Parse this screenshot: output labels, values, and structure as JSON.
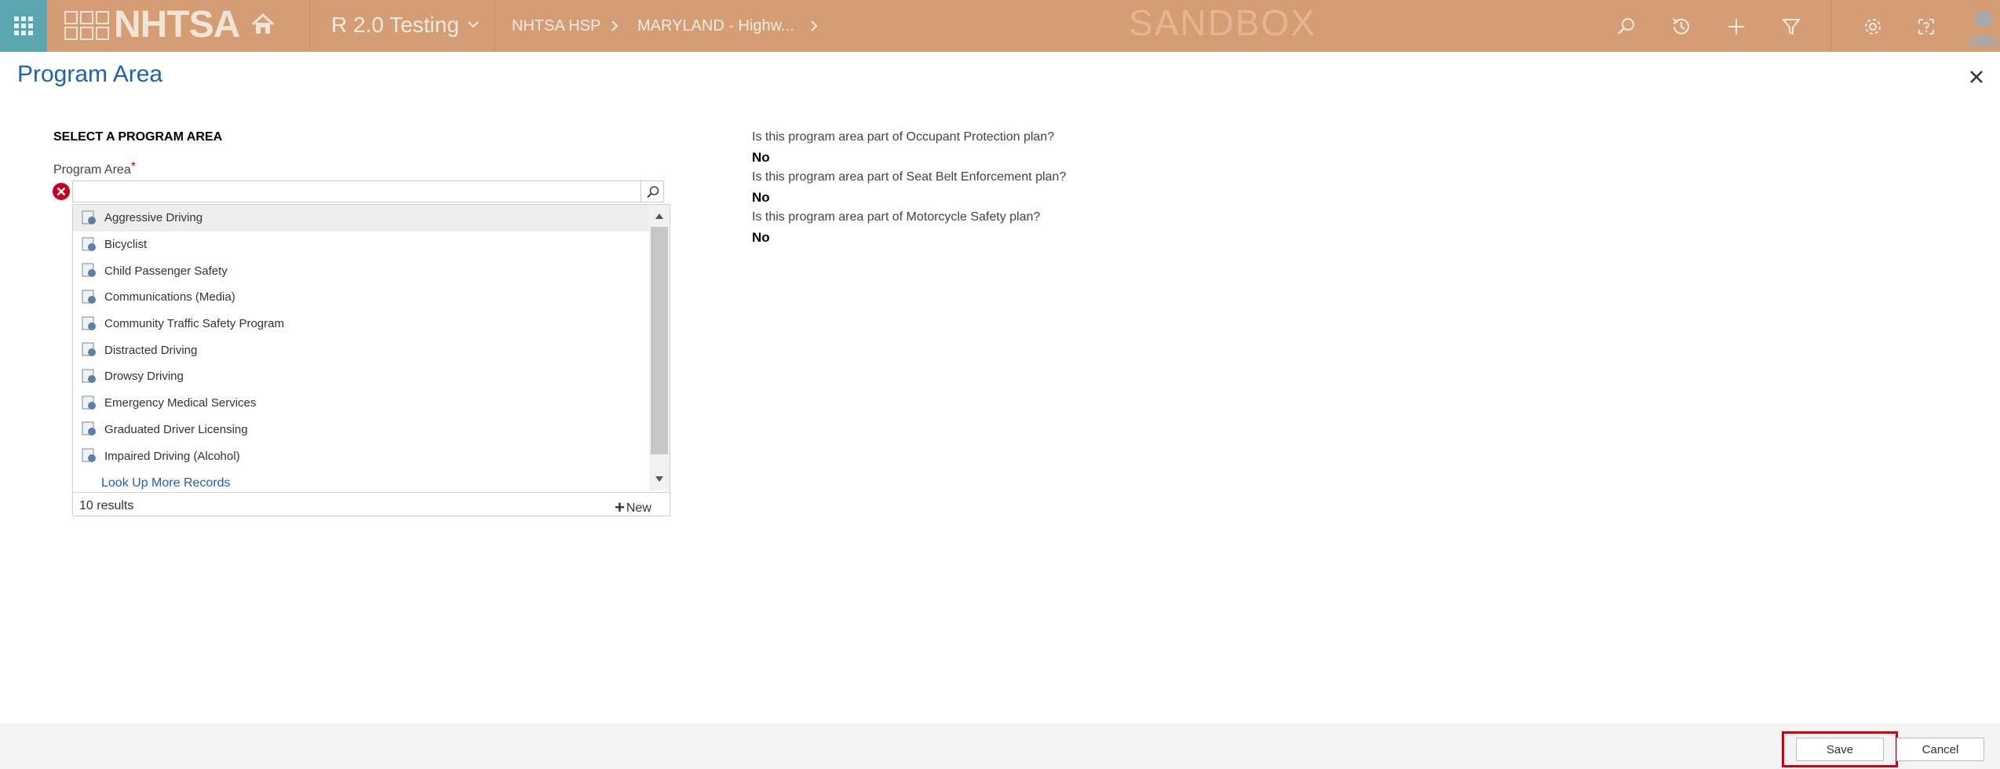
{
  "topbar": {
    "brand": "NHTSA",
    "app_title": "R 2.0 Testing",
    "breadcrumbs": [
      "NHTSA HSP",
      "MARYLAND - Highw..."
    ],
    "environment": "SANDBOX"
  },
  "dialog": {
    "title": "Program Area"
  },
  "left": {
    "section_title": "SELECT A PROGRAM AREA",
    "field_label": "Program Area",
    "required_marker": "*",
    "input_value": "",
    "dropdown": {
      "items": [
        "Aggressive Driving",
        "Bicyclist",
        "Child Passenger Safety",
        "Communications (Media)",
        "Community Traffic Safety Program",
        "Distracted Driving",
        "Drowsy Driving",
        "Emergency Medical Services",
        "Graduated Driver Licensing",
        "Impaired Driving (Alcohol)"
      ],
      "look_up_more": "Look Up More Records",
      "results_count": "10 results",
      "new_label": "New"
    }
  },
  "right": {
    "questions": [
      {
        "q": "Is this program area part of Occupant Protection plan?",
        "a": "No"
      },
      {
        "q": "Is this program area part of Seat Belt Enforcement plan?",
        "a": "No"
      },
      {
        "q": "Is this program area part of Motorcycle Safety plan?",
        "a": "No"
      }
    ]
  },
  "footer": {
    "save_label": "Save",
    "cancel_label": "Cancel"
  },
  "colors": {
    "topbar": "#d59d74",
    "apps_button": "#5aa6b0",
    "title_blue": "#1f63b0",
    "highlight_red": "#d6000d"
  }
}
